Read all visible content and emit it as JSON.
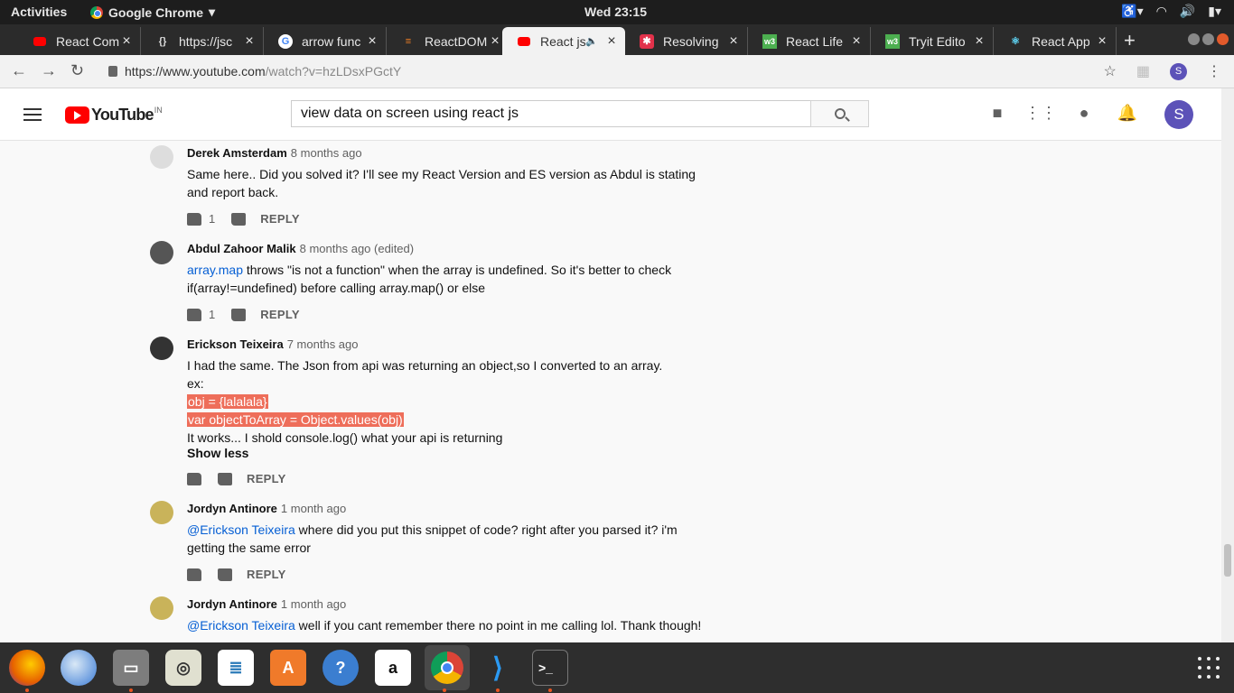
{
  "system": {
    "activities": "Activities",
    "app_name": "Google Chrome",
    "clock": "Wed 23:15"
  },
  "tabs": [
    {
      "label": "React Com",
      "icon": "youtube-icon",
      "color": "#ff0000"
    },
    {
      "label": "https://jsc",
      "icon": "json-icon",
      "color": "#dddddd"
    },
    {
      "label": "arrow func",
      "icon": "google-icon",
      "color": "#4285f4"
    },
    {
      "label": "ReactDOM",
      "icon": "stackoverflow-icon",
      "color": "#f48024"
    },
    {
      "label": "React js",
      "icon": "youtube-icon",
      "color": "#ff0000"
    },
    {
      "label": "Resolving",
      "icon": "reddit-icon",
      "color": "#e2314a"
    },
    {
      "label": "React Life",
      "icon": "w3-icon",
      "color": "#4caf50"
    },
    {
      "label": "Tryit Edito",
      "icon": "w3-icon",
      "color": "#4caf50"
    },
    {
      "label": "React App",
      "icon": "react-icon",
      "color": "#61dafb"
    }
  ],
  "address": {
    "host": "https://www.youtube.com",
    "path": "/watch?v=hzLDsxPGctY"
  },
  "profile_initial": "S",
  "youtube": {
    "logo_text": "YouTube",
    "region": "IN",
    "search_query": "view data on screen using react js"
  },
  "comments": [
    {
      "author": "Derek Amsterdam",
      "time": "8 months ago",
      "lines": [
        "Same here.. Did you solved it? I'll  see my React Version and ES version as Abdul is stating",
        "and report back."
      ],
      "likes": "1",
      "reply": "REPLY"
    },
    {
      "author": "Abdul Zahoor Malik",
      "time": "8 months ago (edited)",
      "link": "array.map",
      "line1_rest": " throws \"is not a function\" when the array is undefined. So it's better to check",
      "line2": "if(array!=undefined) before calling array.map() or else",
      "likes": "1",
      "reply": "REPLY"
    },
    {
      "author": "Erickson Teixeira",
      "time": "7 months ago",
      "line1": "I had the same. The Json from api was returning an object,so I converted to an array.",
      "line2": "ex:",
      "code1": "obj = {lalalala}",
      "code2": "var objectToArray = Object.values(obj)",
      "line3": "It works... I shold console.log() what your api is returning",
      "show_less": "Show less",
      "reply": "REPLY"
    },
    {
      "author": "Jordyn Antinore",
      "time": "1 month ago",
      "mention": "@Erickson Teixeira",
      "line1_rest": " where did you put this snippet of code? right after you parsed it? i'm",
      "line2": "getting the same error",
      "reply": "REPLY"
    },
    {
      "author": "Jordyn Antinore",
      "time": "1 month ago",
      "mention": "@Erickson Teixeira",
      "line1_rest": " well if you cant remember there no point in me calling lol. Thank though!"
    }
  ],
  "colors": {
    "accent": "#065fd4",
    "highlight": "#ee6e5a",
    "ubuntu_orange": "#e95420"
  }
}
